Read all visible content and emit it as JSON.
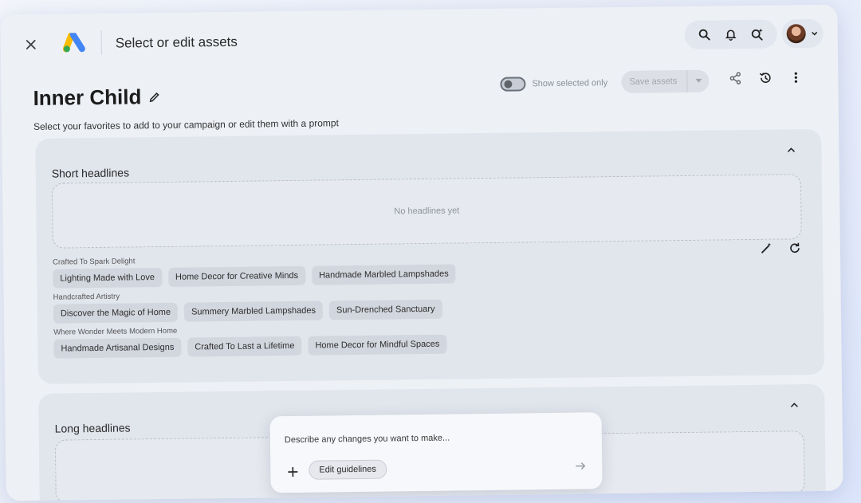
{
  "header": {
    "title": "Select or edit assets",
    "icons": [
      "close-icon",
      "google-ads-logo",
      "search-icon",
      "bell-icon",
      "spark-search-icon",
      "avatar",
      "chevron-down-icon"
    ]
  },
  "page": {
    "title": "Inner Child",
    "subtitle": "Select your favorites to add to your campaign or edit them with a prompt",
    "toggle_label": "Show selected only",
    "save_label": "Save assets"
  },
  "short_headlines": {
    "title": "Short headlines",
    "empty_text": "No headlines yet",
    "groups": [
      {
        "label": "Crafted To Spark Delight",
        "chips": [
          "Lighting Made with Love",
          "Home Decor for Creative Minds",
          "Handmade Marbled Lampshades"
        ]
      },
      {
        "label": "Handcrafted Artistry",
        "chips": [
          "Discover the Magic of Home",
          "Summery Marbled Lampshades",
          "Sun-Drenched Sanctuary"
        ]
      },
      {
        "label": "Where Wonder Meets Modern Home",
        "chips": [
          "Handmade Artisanal Designs",
          "Crafted To Last a Lifetime",
          "Home Decor for Mindful Spaces"
        ]
      }
    ]
  },
  "long_headlines": {
    "title": "Long headlines"
  },
  "prompt": {
    "placeholder": "Describe any changes you want to make...",
    "guidelines_label": "Edit guidelines"
  },
  "colors": {
    "background": "#edf0f5",
    "card": "#e1e5ec",
    "chip": "#d2d6de",
    "google_blue": "#4285F4",
    "google_yellow": "#FBBC04",
    "google_green": "#34A853"
  }
}
